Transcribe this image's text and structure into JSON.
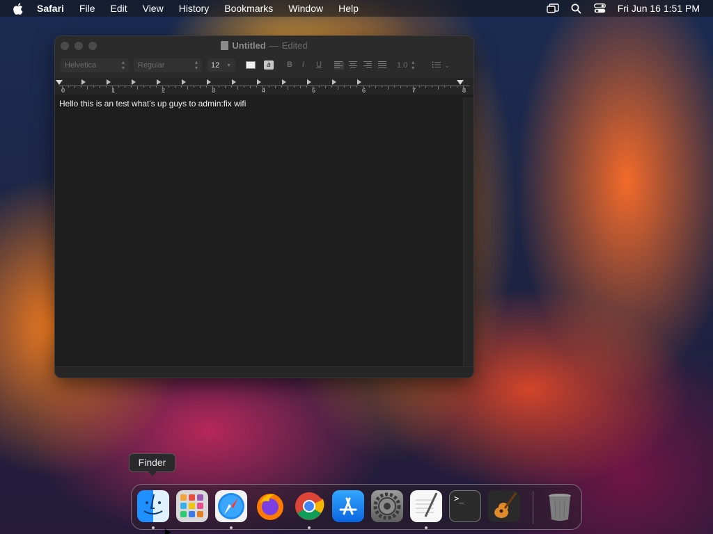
{
  "menubar": {
    "app_name": "Safari",
    "menus": [
      "File",
      "Edit",
      "View",
      "History",
      "Bookmarks",
      "Window",
      "Help"
    ],
    "clock": "Fri Jun 16  1:51 PM",
    "status_icons": [
      "screen-mirroring-icon",
      "search-icon",
      "control-center-icon"
    ]
  },
  "window": {
    "title": "Untitled",
    "title_separator": "—",
    "title_status": "Edited",
    "toolbar": {
      "font_family": "Helvetica",
      "font_style": "Regular",
      "font_size": "12",
      "bold": "B",
      "italic": "I",
      "underline": "U",
      "highlight_glyph": "a",
      "line_spacing": "1.0"
    },
    "ruler": {
      "numbers": [
        "0",
        "1",
        "2",
        "3",
        "4",
        "5",
        "6",
        "7",
        "8"
      ]
    },
    "document_text": "Hello this is an test what's up guys to admin:fix wifi"
  },
  "tooltip": {
    "text": "Finder"
  },
  "dock": {
    "apps": [
      {
        "name": "Finder",
        "running": true
      },
      {
        "name": "Launchpad",
        "running": false
      },
      {
        "name": "Safari",
        "running": true
      },
      {
        "name": "Firefox",
        "running": false
      },
      {
        "name": "Google Chrome",
        "running": true
      },
      {
        "name": "App Store",
        "running": false
      },
      {
        "name": "System Settings",
        "running": false
      },
      {
        "name": "TextEdit",
        "running": true
      },
      {
        "name": "Terminal",
        "running": false
      },
      {
        "name": "GarageBand",
        "running": false
      },
      {
        "name": "Trash",
        "running": false
      }
    ],
    "terminal_prompt": ">_"
  },
  "colors": {
    "menubar_text": "#ffffff",
    "window_bg": "#1e1e1e",
    "doc_text": "#f2f2f2",
    "accent_orange": "#ff8c14"
  }
}
